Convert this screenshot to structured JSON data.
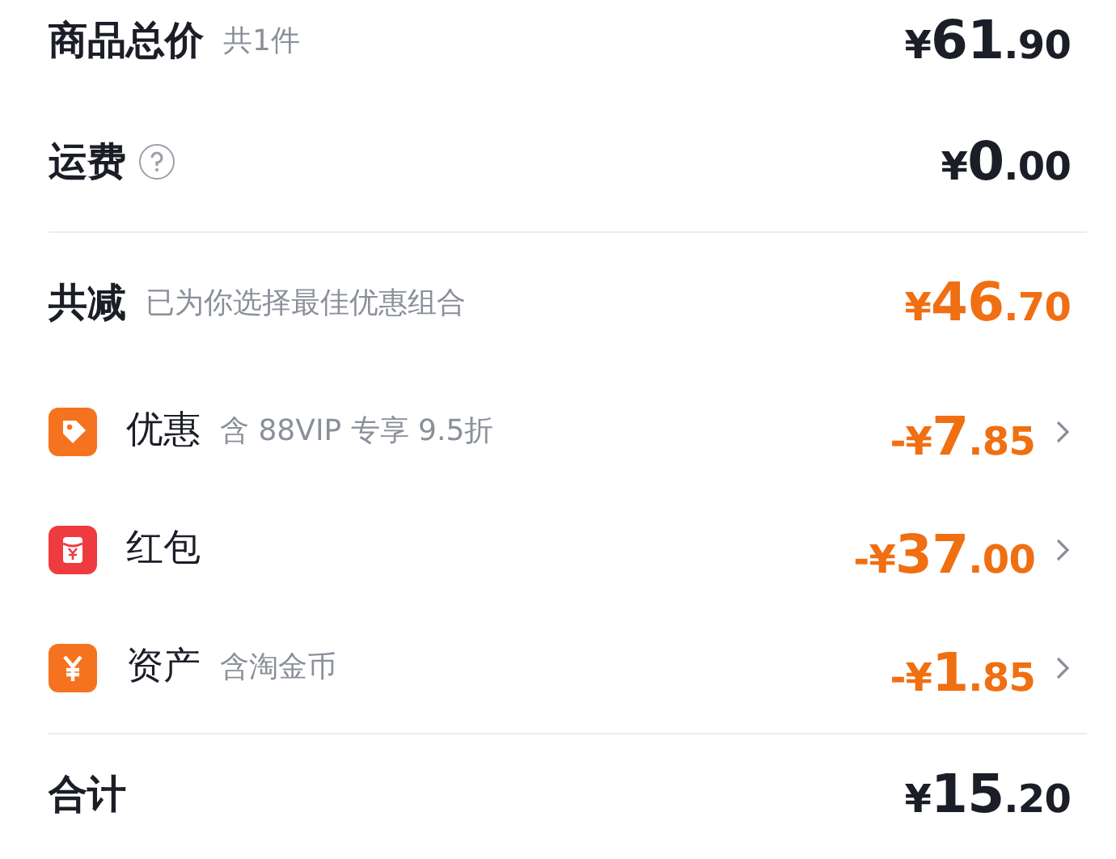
{
  "summary": [
    {
      "label": "商品总价",
      "note": "共1件",
      "price": {
        "symbol": "¥",
        "integer": "61",
        "decimal": ".90"
      }
    },
    {
      "label": "运费",
      "help": true,
      "price": {
        "symbol": "¥",
        "integer": "0",
        "decimal": ".00"
      }
    }
  ],
  "discount": {
    "label": "共减",
    "note": "已为你选择最佳优惠组合",
    "price": {
      "symbol": "¥",
      "integer": "46",
      "decimal": ".70"
    }
  },
  "discount_items": [
    {
      "kind": "tag",
      "label": "优惠",
      "note": "含 88VIP 专享 9.5折",
      "color": "#f5731f",
      "price": {
        "symbol": "-¥",
        "integer": "7",
        "decimal": ".85"
      }
    },
    {
      "kind": "envelope",
      "label": "红包",
      "color": "#ee3b3f",
      "price": {
        "symbol": "-¥",
        "integer": "37",
        "decimal": ".00"
      }
    },
    {
      "kind": "coin",
      "label": "资产",
      "note": "含淘金币",
      "color": "#f5731f",
      "price": {
        "symbol": "-¥",
        "integer": "1",
        "decimal": ".85"
      }
    }
  ],
  "grand_total": {
    "label": "合计",
    "price": {
      "symbol": "¥",
      "integer": "15",
      "decimal": ".20"
    }
  }
}
